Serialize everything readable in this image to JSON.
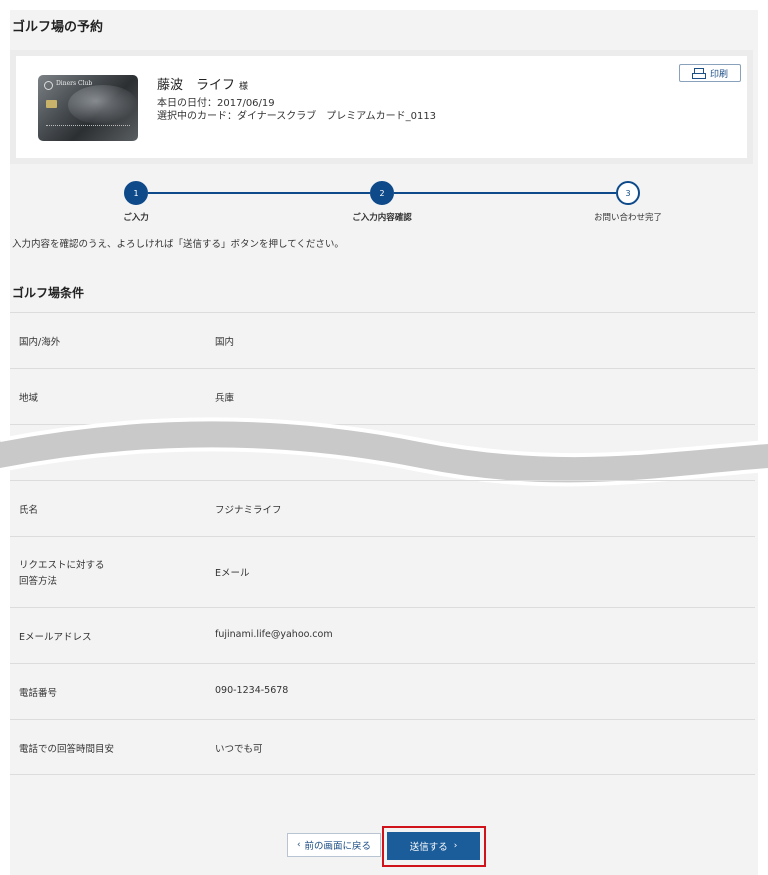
{
  "page": {
    "title": "ゴルフ場の予約"
  },
  "member": {
    "name": "藤波　ライフ",
    "honorific": "様",
    "date_line": "本日の日付：2017/06/19",
    "card_line": "選択中のカード：ダイナースクラブ　プレミアムカード_0113",
    "card_logo_text": "Diners Club",
    "print_label": "印刷"
  },
  "stepper": {
    "steps": [
      {
        "number": "1",
        "label": "ご入力",
        "state": "done"
      },
      {
        "number": "2",
        "label": "ご入力内容確認",
        "state": "current"
      },
      {
        "number": "3",
        "label": "お問い合わせ完了",
        "state": "todo"
      }
    ]
  },
  "instruction": "入力内容を確認のうえ、よろしければ「送信する」ボタンを押してください。",
  "section_title": "ゴルフ場条件",
  "rows_top": [
    {
      "label": "国内/海外",
      "value": "国内"
    },
    {
      "label": "地域",
      "value": "兵庫"
    }
  ],
  "rows_bottom": [
    {
      "label": "氏名",
      "value": "フジナミライフ"
    },
    {
      "label_line1": "リクエストに対する",
      "label_line2": "回答方法",
      "value": "Eメール"
    },
    {
      "label": "Eメールアドレス",
      "value": "fujinami.life@yahoo.com"
    },
    {
      "label": "電話番号",
      "value": "090-1234-5678"
    },
    {
      "label": "電話での回答時間目安",
      "value": "いつでも可"
    }
  ],
  "buttons": {
    "back": "前の画面に戻る",
    "submit": "送信する"
  },
  "colors": {
    "accent": "#0e4a8a",
    "submit_bg": "#1b5c9a",
    "highlight": "#d0121b"
  }
}
